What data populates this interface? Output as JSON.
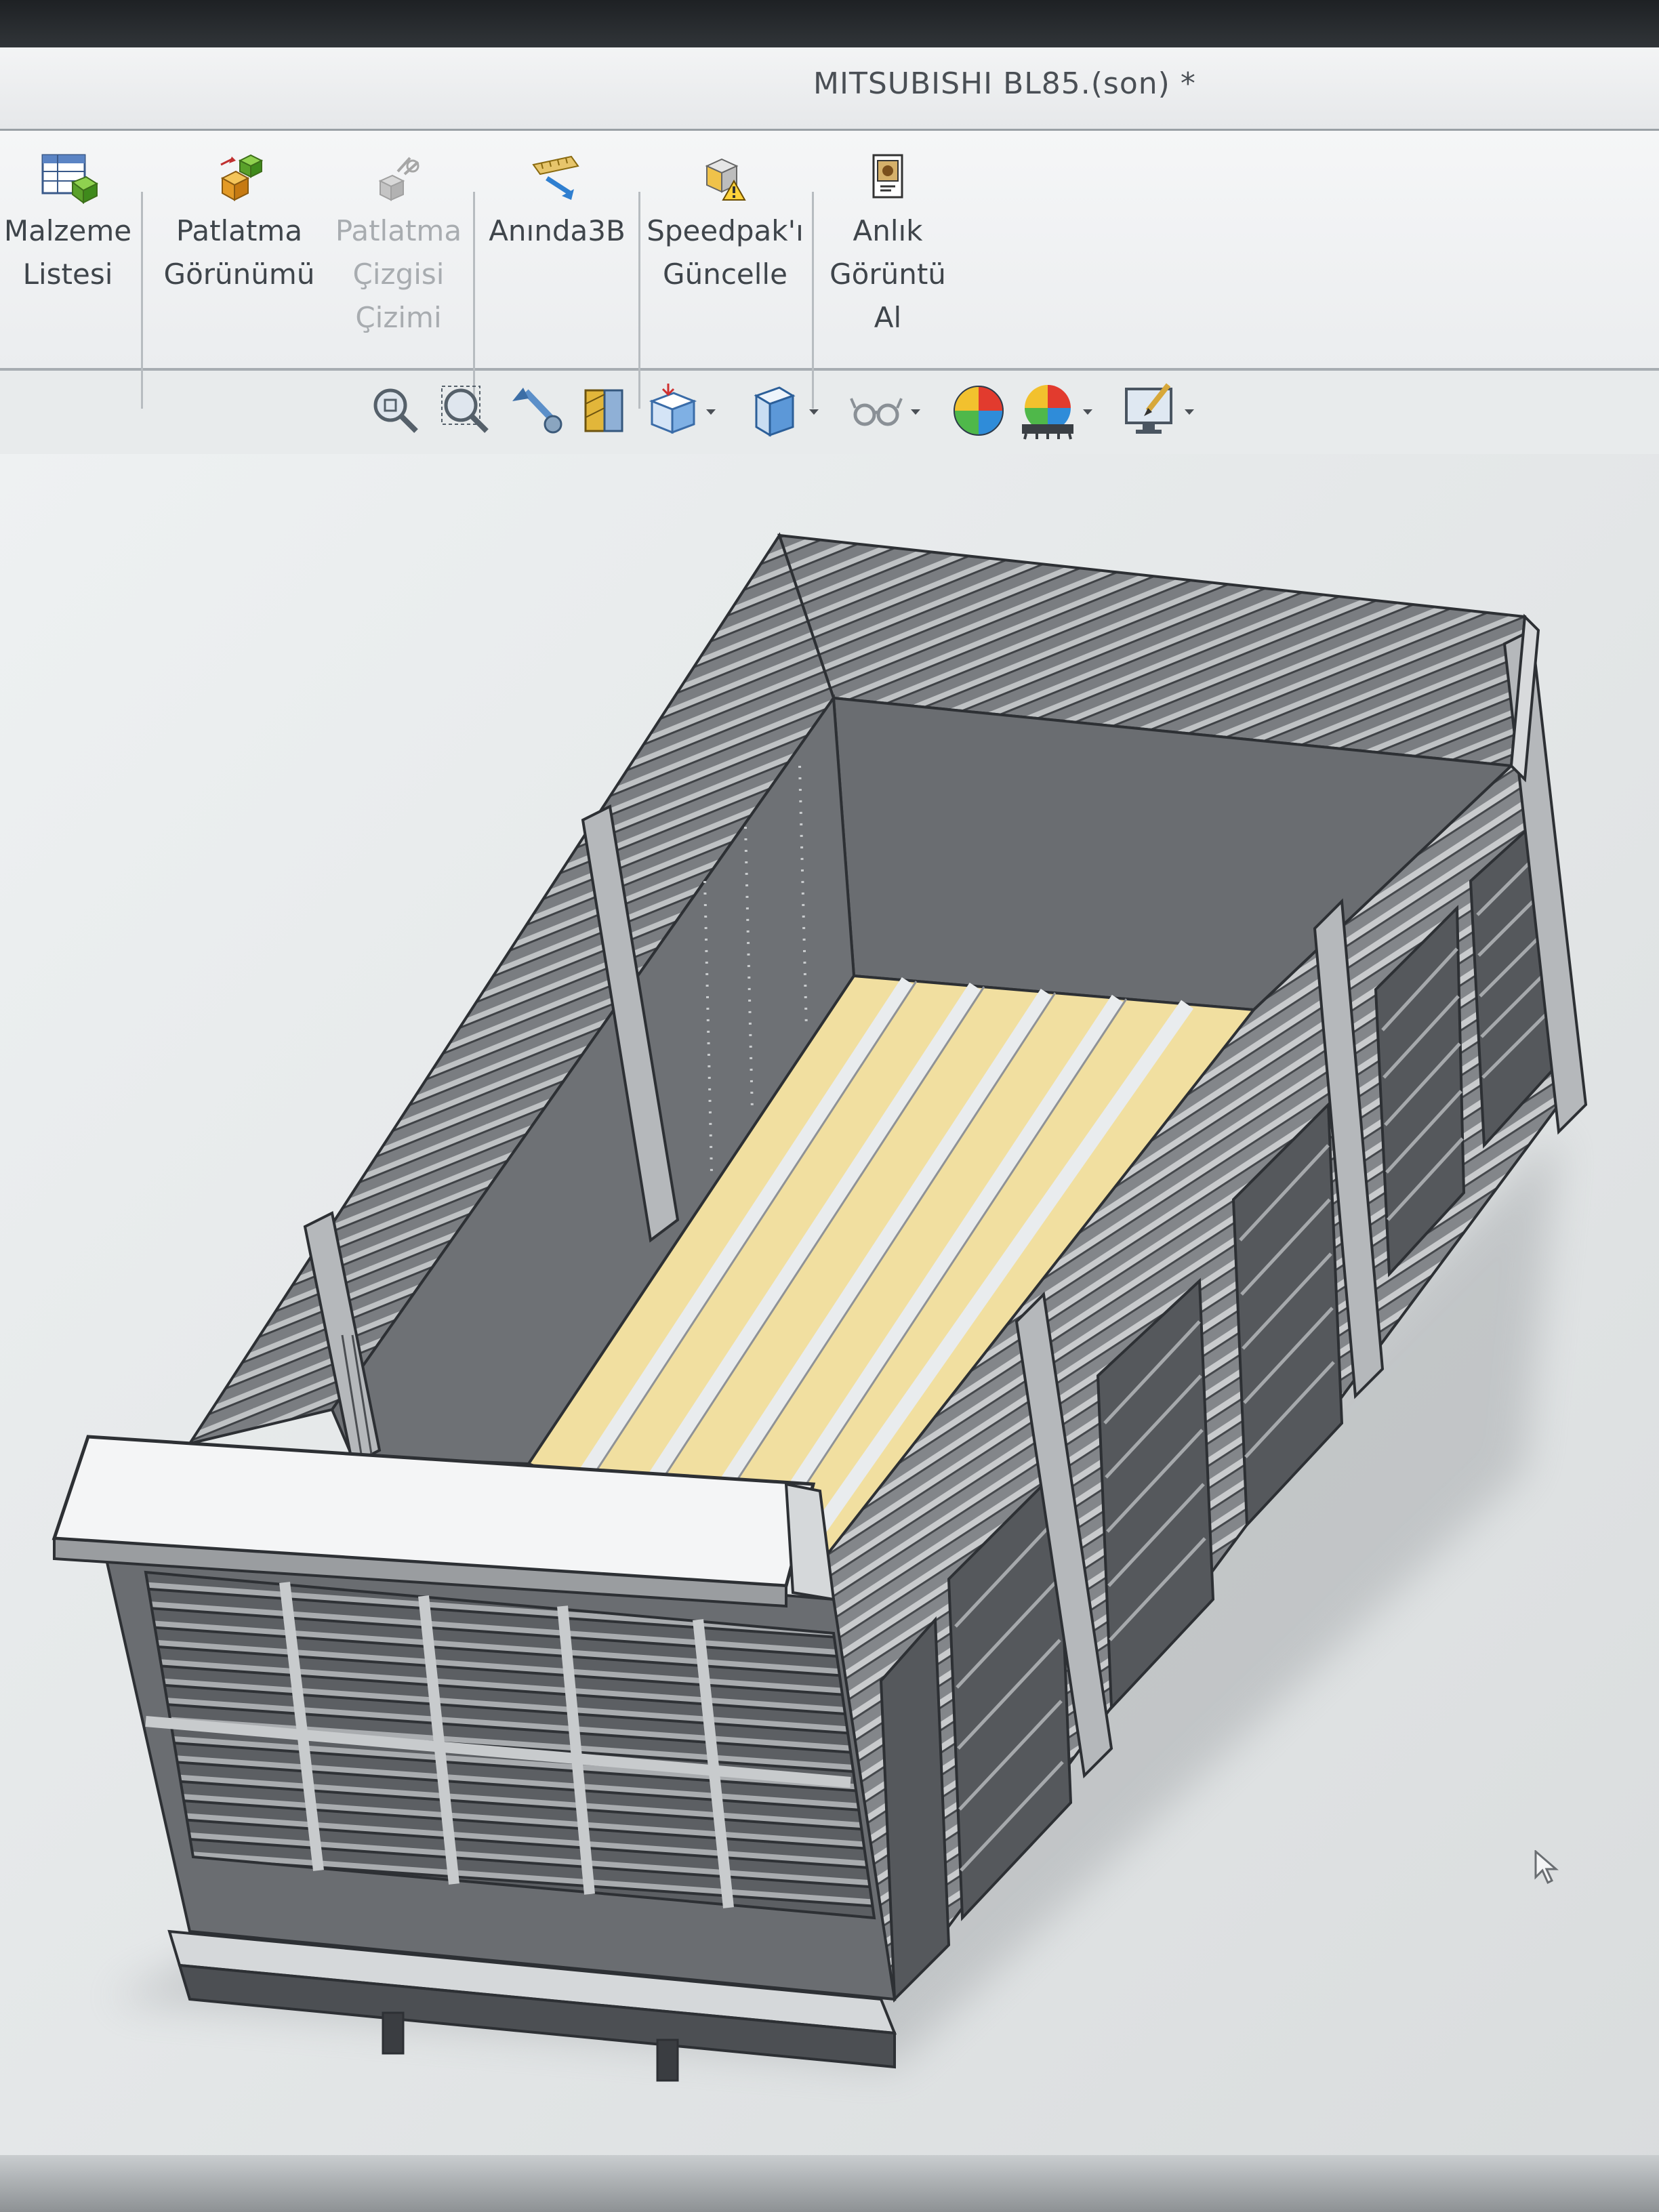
{
  "window": {
    "title": "MITSUBISHI BL85.(son) *"
  },
  "ribbon": {
    "buttons": [
      {
        "label": "Malzeme\nListesi",
        "icon": "bill-of-materials-icon",
        "enabled": true
      },
      {
        "label": "Patlatma\nGörünümü",
        "icon": "exploded-view-icon",
        "enabled": true
      },
      {
        "label": "Patlatma\nÇizgisi\nÇizimi",
        "icon": "explode-line-sketch-icon",
        "enabled": false
      },
      {
        "label": "Anında3B",
        "icon": "instant3d-icon",
        "enabled": true
      },
      {
        "label": "Speedpak'ı\nGüncelle",
        "icon": "update-speedpak-icon",
        "enabled": true
      },
      {
        "label": "Anlık\nGörüntü\nAl",
        "icon": "take-snapshot-icon",
        "enabled": true
      }
    ]
  },
  "view_toolbar": {
    "tools": [
      "zoom-to-fit-icon",
      "zoom-to-area-icon",
      "previous-view-icon",
      "section-view-icon",
      "view-orientation-icon",
      "display-style-icon",
      "hide-show-items-icon",
      "edit-appearance-icon",
      "apply-scene-icon",
      "view-settings-icon"
    ]
  },
  "colors": {
    "ui_background": "#e8ebec",
    "model_body": "#6b6e72",
    "floor_wood": "#f1dfa0",
    "ribbon_text": "#3f454b",
    "disabled_text": "#a8acb0"
  }
}
